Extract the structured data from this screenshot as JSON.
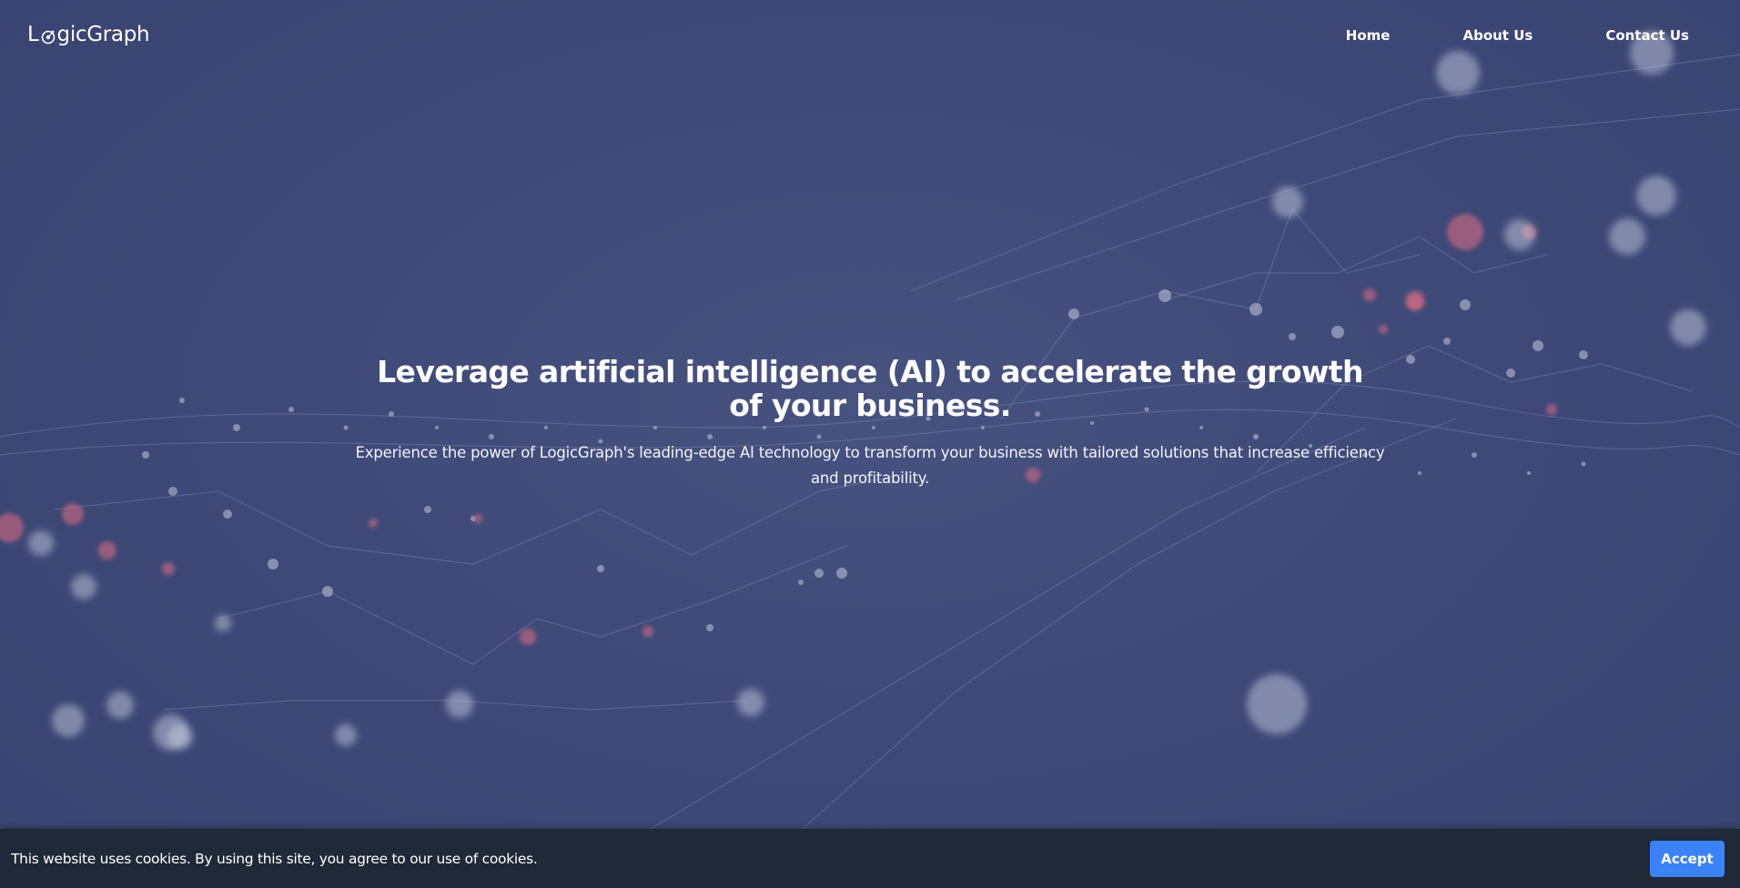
{
  "navbar": {
    "logo_text_prefix": "L",
    "logo_text_suffix": "gicGraph",
    "links": [
      {
        "label": "Home"
      },
      {
        "label": "About Us"
      },
      {
        "label": "Contact Us"
      }
    ]
  },
  "hero": {
    "title": "Leverage artificial intelligence (AI) to accelerate the growth of your business.",
    "subtitle": "Experience the power of LogicGraph's leading-edge AI technology to transform your business with tailored solutions that increase efficiency and profitability."
  },
  "cookie_banner": {
    "message": "This website uses cookies. By using this site, you agree to our use of cookies.",
    "accept_label": "Accept"
  },
  "colors": {
    "background": "#3d4876",
    "cookie_bar": "#1f2937",
    "accept_button": "#3b82f6",
    "network_node_light": "#b8bdd6",
    "network_node_red": "#c0566e"
  }
}
